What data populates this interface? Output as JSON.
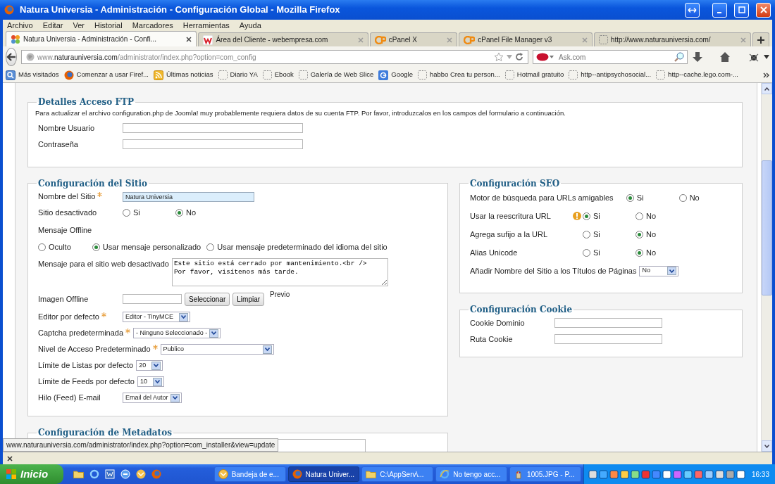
{
  "window": {
    "title": "Natura Universia - Administración - Configuración Global - Mozilla Firefox"
  },
  "menu": [
    "Archivo",
    "Editar",
    "Ver",
    "Historial",
    "Marcadores",
    "Herramientas",
    "Ayuda"
  ],
  "tabs": [
    {
      "label": "Natura Universia - Administración - Confi...",
      "kind": "joomla",
      "selected": true
    },
    {
      "label": "Área del Cliente - webempresa.com",
      "kind": "webempresa",
      "selected": false
    },
    {
      "label": "cPanel X",
      "kind": "cpanel",
      "selected": false
    },
    {
      "label": "cPanel File Manager v3",
      "kind": "cpanel",
      "selected": false
    },
    {
      "label": "http://www.naturauniversia.com/",
      "kind": "blank",
      "selected": false
    }
  ],
  "address": {
    "url": "www.**naturauniversia.com**/administrator/index.php?option=com_config"
  },
  "search": {
    "placeholder": "Ask.com"
  },
  "bookmarks": [
    {
      "label": "Más visitados",
      "kind": "smart"
    },
    {
      "label": "Comenzar a usar Firef...",
      "kind": "firefox"
    },
    {
      "label": "Últimas noticias",
      "kind": "feed"
    },
    {
      "label": "Diario YA",
      "kind": "blank"
    },
    {
      "label": "Ebook",
      "kind": "blank"
    },
    {
      "label": "Galería de Web Slice",
      "kind": "blank"
    },
    {
      "label": "Google",
      "kind": "google"
    },
    {
      "label": "habbo Crea tu person...",
      "kind": "blank"
    },
    {
      "label": "Hotmail gratuito",
      "kind": "blank"
    },
    {
      "label": "http--antipsychosocial...",
      "kind": "blank"
    },
    {
      "label": "http--cache.lego.com-...",
      "kind": "blank"
    }
  ],
  "ftp": {
    "legend": "Detalles Acceso FTP",
    "description": "Para actualizar el archivo configuration.php de Joomla! muy probablemente requiera datos de su cuenta FTP. Por favor, introduzcalos en los campos del formulario a continuación.",
    "fields": [
      {
        "label": "Nombre Usuario"
      },
      {
        "label": "Contraseña"
      }
    ]
  },
  "site": {
    "legend": "Configuración del Sitio",
    "rows": [
      {
        "kind": "text",
        "label": "Nombre del Sitio",
        "required": true,
        "value": "Natura Universia",
        "focused": true
      },
      {
        "kind": "radio",
        "label": "Sitio desactivado",
        "options": [
          {
            "label": "Si",
            "selected": false
          },
          {
            "label": "No",
            "selected": true
          }
        ]
      },
      {
        "kind": "heading",
        "label": "Mensaje Offline"
      },
      {
        "kind": "radio-line",
        "options": [
          {
            "label": "Oculto",
            "selected": false
          },
          {
            "label": "Usar mensaje personalizado",
            "selected": true
          },
          {
            "label": "Usar mensaje predeterminado del idioma del sitio",
            "selected": false
          }
        ]
      },
      {
        "kind": "textarea",
        "label": "Mensaje para el sitio web desactivado",
        "value": "Este sitio está cerrado por mantenimiento.<br />\nPor favor, visítenos más tarde."
      },
      {
        "kind": "image",
        "label": "Imagen Offline",
        "buttons": [
          "Seleccionar",
          "Limpiar"
        ],
        "note": "Previo"
      },
      {
        "kind": "select",
        "label": "Editor por defecto",
        "required": true,
        "value": "Editor - TinyMCE"
      },
      {
        "kind": "select",
        "label": "Captcha predeterminada",
        "required": true,
        "value": "- Ninguno Seleccionado -"
      },
      {
        "kind": "select",
        "label": "Nivel de Acceso Predeterminado",
        "required": true,
        "value": "Publico"
      },
      {
        "kind": "select",
        "label": "Límite de Listas por defecto",
        "required": false,
        "value": "20"
      },
      {
        "kind": "select",
        "label": "Límite de Feeds por defecto",
        "required": false,
        "value": "10"
      },
      {
        "kind": "select",
        "label": "Hilo (Feed) E-mail",
        "required": false,
        "value": "Email del Autor"
      }
    ]
  },
  "seo": {
    "legend": "Configuración SEO",
    "rows": [
      {
        "kind": "radio",
        "label": "Motor de búsqueda para URLs amigables",
        "warning": false,
        "options": [
          {
            "label": "Si",
            "selected": true
          },
          {
            "label": "No",
            "selected": false
          }
        ]
      },
      {
        "kind": "radio",
        "label": "Usar la reescritura URL",
        "warning": true,
        "options": [
          {
            "label": "Si",
            "selected": true
          },
          {
            "label": "No",
            "selected": false
          }
        ]
      },
      {
        "kind": "radio",
        "label": "Agrega sufijo a la URL",
        "warning": false,
        "options": [
          {
            "label": "Si",
            "selected": false
          },
          {
            "label": "No",
            "selected": true
          }
        ]
      },
      {
        "kind": "radio",
        "label": "Alias Unicode",
        "warning": false,
        "options": [
          {
            "label": "Si",
            "selected": false
          },
          {
            "label": "No",
            "selected": true
          }
        ]
      },
      {
        "kind": "select",
        "label": "Añadir Nombre del Sitio a los Títulos de Páginas",
        "value": "No"
      }
    ]
  },
  "cookie": {
    "legend": "Configuración Cookie",
    "fields": [
      {
        "label": "Cookie Dominio"
      },
      {
        "label": "Ruta Cookie"
      }
    ]
  },
  "metadata": {
    "legend": "Configuración de Metadatos"
  },
  "status_bar": {
    "url": "www.naturauniversia.com/administrator/index.php?option=com_installer&view=update"
  },
  "taskbar": {
    "start": "Inicio",
    "tasks": [
      {
        "label": "Bandeja de e...",
        "kind": "mail",
        "selected": false
      },
      {
        "label": "Natura Univer...",
        "kind": "firefox",
        "selected": true
      },
      {
        "label": "C:\\AppServ\\...",
        "kind": "folder",
        "selected": false
      },
      {
        "label": "No tengo acc...",
        "kind": "ie",
        "selected": false
      },
      {
        "label": "1005.JPG - P...",
        "kind": "paint",
        "selected": false
      }
    ],
    "clock": "16:33"
  }
}
